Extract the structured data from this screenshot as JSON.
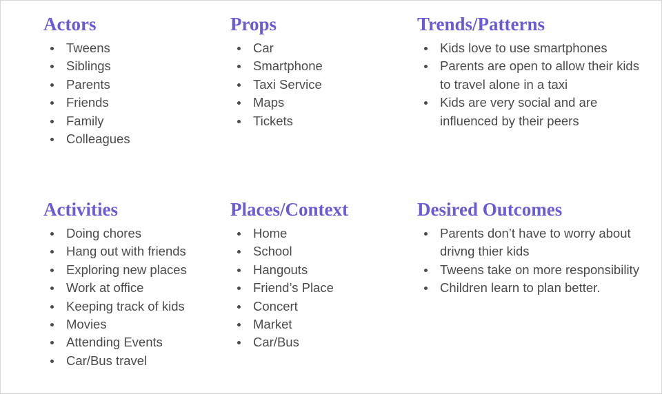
{
  "sections": {
    "actors": {
      "title": "Actors",
      "items": [
        "Tweens",
        "Siblings",
        "Parents",
        "Friends",
        "Family",
        "Colleagues"
      ]
    },
    "props": {
      "title": "Props",
      "items": [
        "Car",
        "Smartphone",
        "Taxi Service",
        "Maps",
        "Tickets"
      ]
    },
    "trends": {
      "title": "Trends/Patterns",
      "items": [
        "Kids love to use smartphones",
        "Parents are open to allow their kids to travel alone in a taxi",
        "Kids are very social and are influenced by their peers"
      ]
    },
    "activities": {
      "title": "Activities",
      "items": [
        "Doing chores",
        "Hang out with friends",
        "Exploring new places",
        "Work at office",
        "Keeping track of kids",
        "Movies",
        "Attending Events",
        "Car/Bus travel"
      ]
    },
    "places": {
      "title": "Places/Context",
      "items": [
        "Home",
        "School",
        "Hangouts",
        "Friend’s Place",
        "Concert",
        "Market",
        "Car/Bus"
      ]
    },
    "outcomes": {
      "title": "Desired Outcomes",
      "items": [
        "Parents don’t have to worry about drivng thier kids",
        "Tweens take on more responsibility",
        "Children learn to plan better."
      ]
    }
  },
  "colors": {
    "heading": "#6a5bd6",
    "body_text": "#4a4a4a",
    "background": "#ffffff"
  }
}
